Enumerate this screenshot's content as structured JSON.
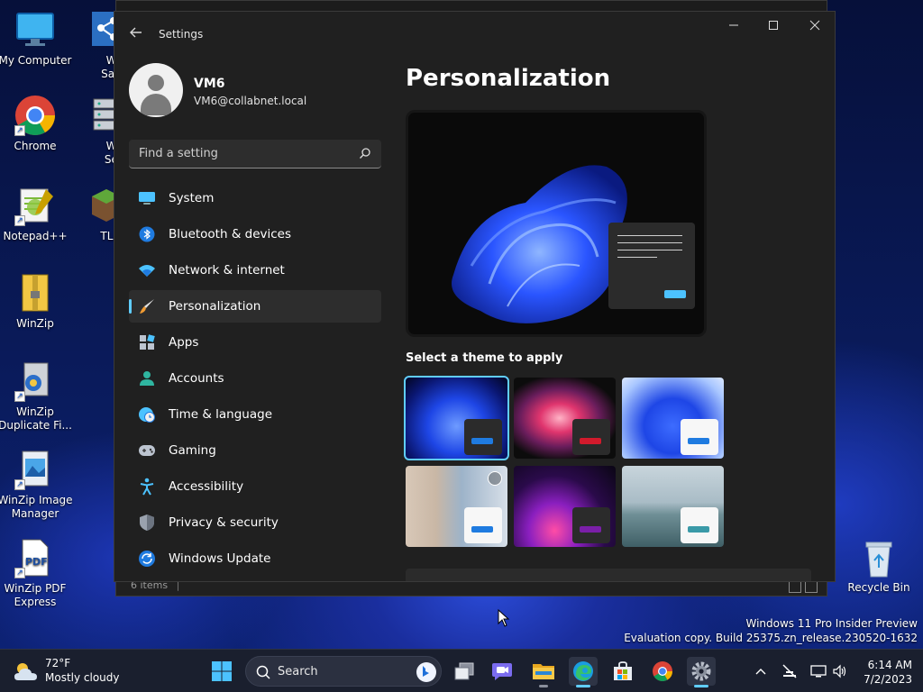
{
  "desktop": {
    "icons": [
      {
        "label": "My Computer"
      },
      {
        "label": "Chrome"
      },
      {
        "label": "Notepad++"
      },
      {
        "label": "WinZip"
      },
      {
        "label": "WinZip Duplicate Fi..."
      },
      {
        "label": "WinZip Image Manager"
      },
      {
        "label": "WinZip PDF Express"
      },
      {
        "label": "WinZ SafeSh"
      },
      {
        "label": "WinZ Secur"
      },
      {
        "label": "TLaunc"
      }
    ],
    "recycle_bin": "Recycle Bin",
    "watermark_line1": "Windows 11 Pro Insider Preview",
    "watermark_line2": "Evaluation copy. Build 25375.zn_release.230520-1632"
  },
  "explorer": {
    "status": "6 items"
  },
  "settings": {
    "title": "Settings",
    "user_name": "VM6",
    "user_email": "VM6@collabnet.local",
    "search_placeholder": "Find a setting",
    "nav": [
      {
        "label": "System",
        "icon": "monitor-icon"
      },
      {
        "label": "Bluetooth & devices",
        "icon": "bluetooth-icon"
      },
      {
        "label": "Network & internet",
        "icon": "wifi-icon"
      },
      {
        "label": "Personalization",
        "icon": "brush-icon",
        "active": true
      },
      {
        "label": "Apps",
        "icon": "apps-icon"
      },
      {
        "label": "Accounts",
        "icon": "person-icon"
      },
      {
        "label": "Time & language",
        "icon": "clock-globe-icon"
      },
      {
        "label": "Gaming",
        "icon": "gamepad-icon"
      },
      {
        "label": "Accessibility",
        "icon": "accessibility-icon"
      },
      {
        "label": "Privacy & security",
        "icon": "shield-icon"
      },
      {
        "label": "Windows Update",
        "icon": "update-icon"
      }
    ],
    "page_title": "Personalization",
    "theme_section_label": "Select a theme to apply"
  },
  "taskbar": {
    "temperature": "72°F",
    "condition": "Mostly cloudy",
    "search_placeholder": "Search",
    "time": "6:14 AM",
    "date": "7/2/2023"
  },
  "colors": {
    "accent": "#60cdff",
    "window_bg": "#202020",
    "selected_nav_bg": "#2d2d2d"
  }
}
